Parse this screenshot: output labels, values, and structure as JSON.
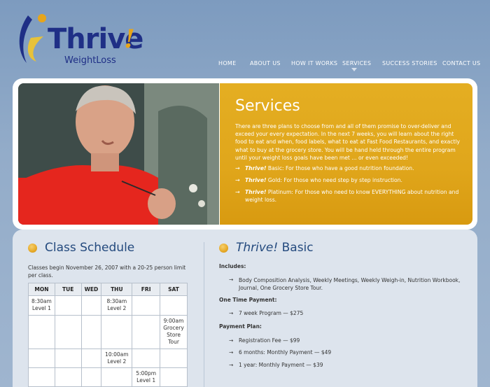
{
  "logo": {
    "word": "Thrive",
    "excl": "!",
    "sub": "WeightLoss"
  },
  "nav": {
    "items": [
      {
        "label": "HOME"
      },
      {
        "label": "ABOUT US"
      },
      {
        "label": "HOW IT WORKS"
      },
      {
        "label": "SERVICES"
      },
      {
        "label": "SUCCESS STORIES"
      },
      {
        "label": "CONTACT US"
      }
    ],
    "active": "SERVICES"
  },
  "hero": {
    "title": "Services",
    "text": "There are three plans to choose from and all of them promise to over-deliver and exceed your every expectation. In the next 7 weeks, you will learn about the right food to eat and when, food labels, what to eat at Fast Food Restaurants, and exactly what to buy at the grocery store. You will be hand held through the entire program until your weight loss goals have been met ... or even exceeded!",
    "plans": [
      {
        "name": "Thrive!",
        "level": " Basic",
        "desc": ": For those who have a good nutrition foundation."
      },
      {
        "name": "Thrive!",
        "level": " Gold",
        "desc": ": For those who need step by step instruction."
      },
      {
        "name": "Thrive!",
        "level": " Platinum",
        "desc": ": For those who need to know EVERYTHING about nutrition and weight loss."
      }
    ]
  },
  "schedule": {
    "title": "Class Schedule",
    "intro": "Classes begin November 26, 2007 with a 20-25 person limit per class.",
    "days": [
      "MON",
      "TUE",
      "WED",
      "THU",
      "FRI",
      "SAT"
    ],
    "rows": [
      [
        "8:30am Level 1",
        "",
        "",
        "8:30am Level 2",
        "",
        ""
      ],
      [
        "",
        "",
        "",
        "",
        "",
        "9:00am Grocery Store Tour"
      ],
      [
        "",
        "",
        "",
        "10:00am Level 2",
        "",
        ""
      ],
      [
        "",
        "",
        "",
        "",
        "5:00pm Level 1",
        ""
      ]
    ]
  },
  "basic": {
    "title_brand": "Thrive!",
    "title_rest": " Basic",
    "includes_label": "Includes:",
    "includes": "Body Composition Analysis, Weekly Meetings, Weekly Weigh-in, Nutrition Workbook, Journal, One Grocery Store Tour.",
    "one_time_label": "One Time Payment:",
    "one_time": "7 week Program — $275",
    "plan_label": "Payment Plan:",
    "plan": [
      "Registration Fee — $99",
      "6 months: Monthly Payment — $49",
      "1 year: Monthly Payment — $39"
    ]
  },
  "colors": {
    "accent": "#e0a61b",
    "brand": "#1f2f86",
    "heading": "#244a7e"
  },
  "icons": {
    "arrow": "→",
    "bullet": "orange-dot"
  }
}
